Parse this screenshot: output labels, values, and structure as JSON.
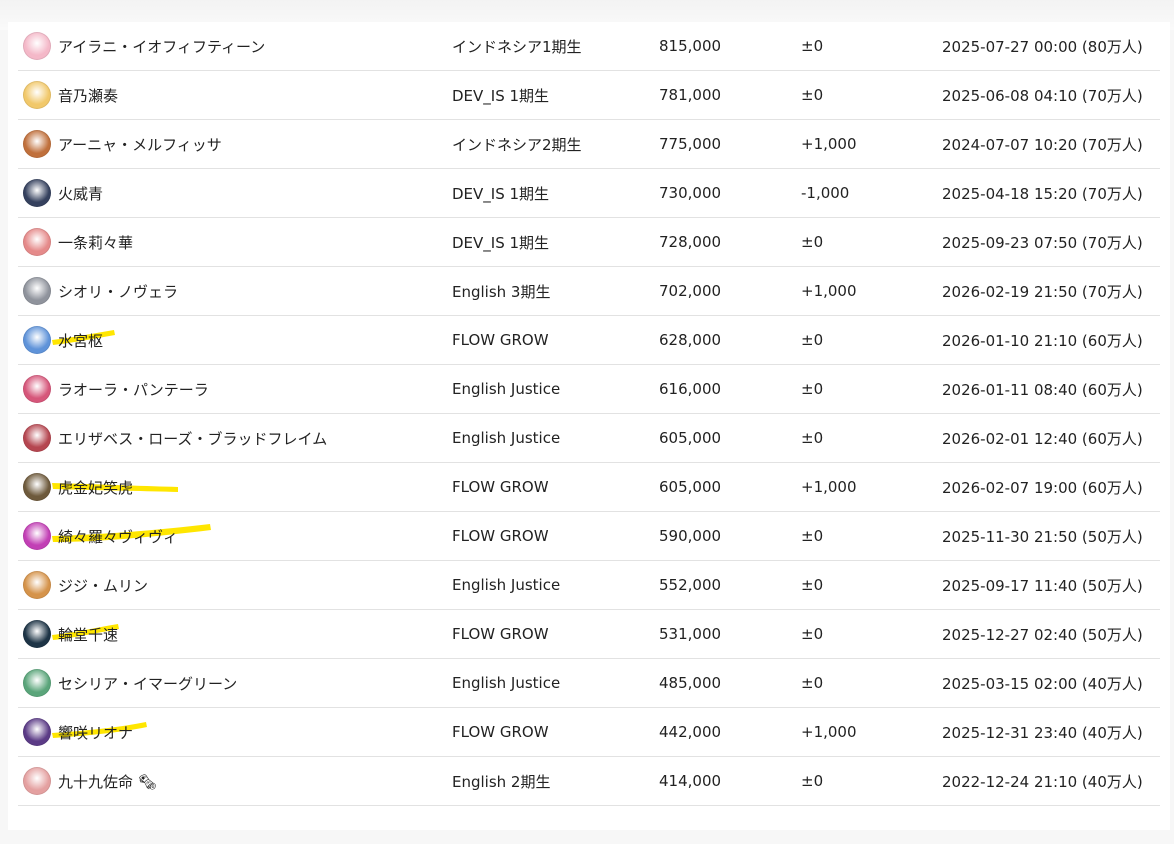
{
  "rows": [
    {
      "name": "アイラニ・イオフィフティーン",
      "group": "インドネシア1期生",
      "count": "815,000",
      "diff": "±0",
      "date": "2025-07-27 00:00 (80万人)",
      "avatar_color": "#f4b8c8",
      "highlighted": false
    },
    {
      "name": "音乃瀬奏",
      "group": "DEV_IS 1期生",
      "count": "781,000",
      "diff": "±0",
      "date": "2025-06-08 04:10 (70万人)",
      "avatar_color": "#f1c86a",
      "highlighted": false
    },
    {
      "name": "アーニャ・メルフィッサ",
      "group": "インドネシア2期生",
      "count": "775,000",
      "diff": "+1,000",
      "date": "2024-07-07 10:20 (70万人)",
      "avatar_color": "#c0703c",
      "highlighted": false
    },
    {
      "name": "火威青",
      "group": "DEV_IS 1期生",
      "count": "730,000",
      "diff": "-1,000",
      "date": "2025-04-18 15:20 (70万人)",
      "avatar_color": "#35415e",
      "highlighted": false
    },
    {
      "name": "一条莉々華",
      "group": "DEV_IS 1期生",
      "count": "728,000",
      "diff": "±0",
      "date": "2025-09-23 07:50 (70万人)",
      "avatar_color": "#e58a8a",
      "highlighted": false
    },
    {
      "name": "シオリ・ノヴェラ",
      "group": "English 3期生",
      "count": "702,000",
      "diff": "+1,000",
      "date": "2026-02-19 21:50 (70万人)",
      "avatar_color": "#8f939c",
      "highlighted": false
    },
    {
      "name": "水宮枢",
      "group": "FLOW GROW",
      "count": "628,000",
      "diff": "±0",
      "date": "2026-01-10 21:10 (60万人)",
      "avatar_color": "#5f93d9",
      "highlighted": true
    },
    {
      "name": "ラオーラ・パンテーラ",
      "group": "English Justice",
      "count": "616,000",
      "diff": "±0",
      "date": "2026-01-11 08:40 (60万人)",
      "avatar_color": "#d6567a",
      "highlighted": false
    },
    {
      "name": "エリザベス・ローズ・ブラッドフレイム",
      "group": "English Justice",
      "count": "605,000",
      "diff": "±0",
      "date": "2026-02-01 12:40 (60万人)",
      "avatar_color": "#b54650",
      "highlighted": false
    },
    {
      "name": "虎金妃笑虎",
      "group": "FLOW GROW",
      "count": "605,000",
      "diff": "+1,000",
      "date": "2026-02-07 19:00 (60万人)",
      "avatar_color": "#6e5a3c",
      "highlighted": true
    },
    {
      "name": "綺々羅々ヴィヴィ",
      "group": "FLOW GROW",
      "count": "590,000",
      "diff": "±0",
      "date": "2025-11-30 21:50 (50万人)",
      "avatar_color": "#c23fb5",
      "highlighted": true
    },
    {
      "name": "ジジ・ムリン",
      "group": "English Justice",
      "count": "552,000",
      "diff": "±0",
      "date": "2025-09-17 11:40 (50万人)",
      "avatar_color": "#d5934a",
      "highlighted": false
    },
    {
      "name": "輪堂千速",
      "group": "FLOW GROW",
      "count": "531,000",
      "diff": "±0",
      "date": "2025-12-27 02:40 (50万人)",
      "avatar_color": "#1d3446",
      "highlighted": true
    },
    {
      "name": "セシリア・イマーグリーン",
      "group": "English Justice",
      "count": "485,000",
      "diff": "±0",
      "date": "2025-03-15 02:00 (40万人)",
      "avatar_color": "#5aa57a",
      "highlighted": false
    },
    {
      "name": "響咲リオナ",
      "group": "FLOW GROW",
      "count": "442,000",
      "diff": "+1,000",
      "date": "2025-12-31 23:40 (40万人)",
      "avatar_color": "#5b3b86",
      "highlighted": true
    },
    {
      "name": "九十九佐命 🗞",
      "group": "English 2期生",
      "count": "414,000",
      "diff": "±0",
      "date": "2022-12-24 21:10 (40万人)",
      "avatar_color": "#e4a0a0",
      "highlighted": false
    }
  ],
  "highlight_color": "#ffe600"
}
